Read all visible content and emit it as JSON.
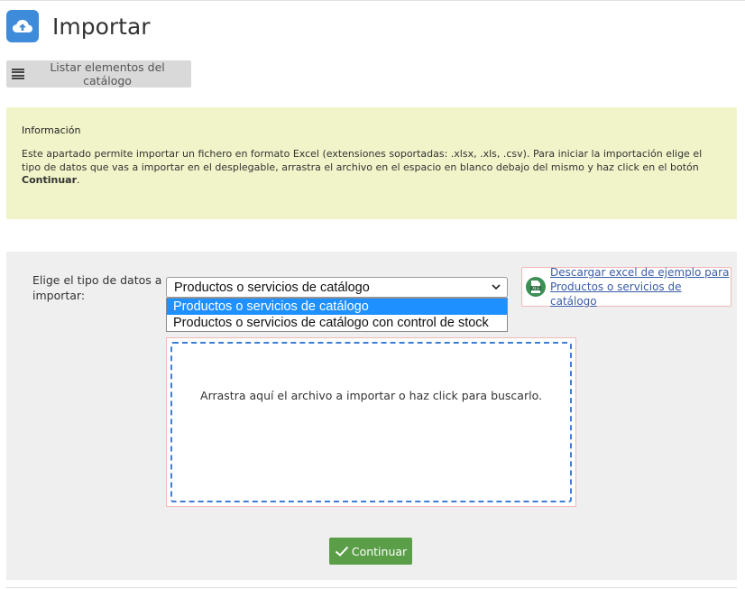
{
  "header": {
    "title": "Importar",
    "icon": "cloud-upload-icon",
    "icon_color": "#3d8bd9"
  },
  "toolbar": {
    "list_label": "Listar elementos del catálogo",
    "list_icon": "list-icon"
  },
  "info": {
    "title": "Información",
    "text_before": "Este apartado permite importar un fichero en formato Excel (extensiones soportadas: .xlsx, .xls, .csv). Para iniciar la importación elige el tipo de datos que vas a importar en el desplegable, arrastra el archivo en el espacio en blanco debajo del mismo y haz click en el botón ",
    "text_bold": "Continuar",
    "text_after": ".",
    "background": "#f1f4c9"
  },
  "form": {
    "select_label": "Elige el tipo de datos a importar:",
    "selected_value": "Productos o servicios de catálogo",
    "options": [
      "Productos o servicios de catálogo",
      "Productos o servicios de catálogo con control de stock"
    ],
    "selected_index": 0,
    "download": {
      "icon": "xls-file-icon",
      "line1": "Descargar excel de ejemplo para",
      "line2": "Productos o servicios de catálogo"
    },
    "drop_text": "Arrastra aquí el archivo a importar o haz click para buscarlo.",
    "continue_label": "Continuar",
    "continue_color": "#5a9e47"
  }
}
